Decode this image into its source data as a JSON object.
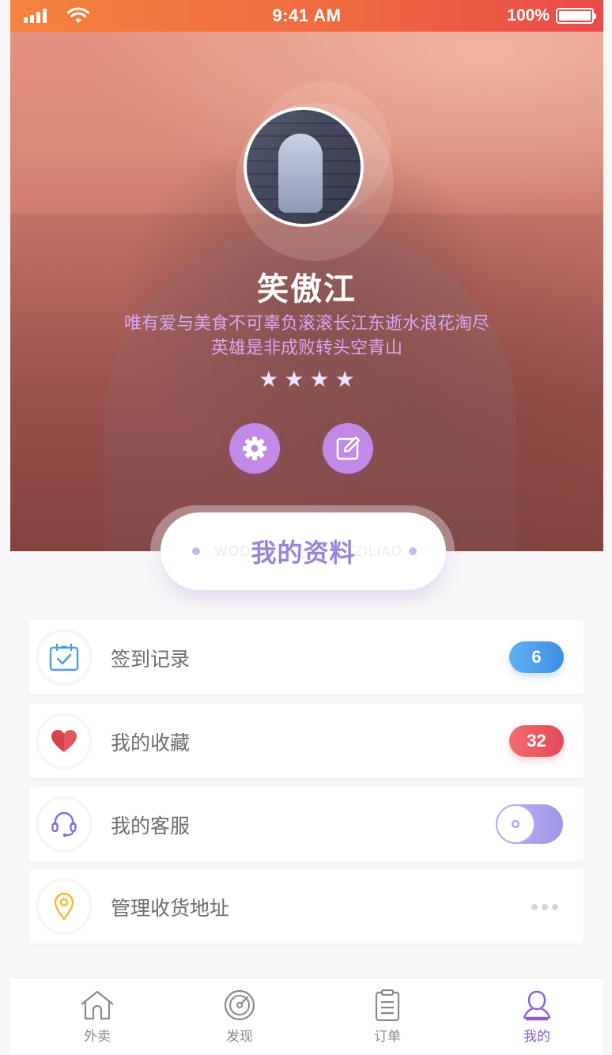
{
  "status_bar": {
    "time": "9:41 AM",
    "battery": "100%"
  },
  "profile": {
    "name": "笑傲江",
    "bio_line1": "唯有爱与美食不可辜负滚滚长江东逝水浪花淘尽",
    "bio_line2": "英雄是非成败转头空青山",
    "star_rating": 4,
    "star_glyph": "★"
  },
  "actions": {
    "settings_icon": "gear-icon",
    "edit_icon": "edit-icon"
  },
  "section": {
    "title": "我的资料",
    "sub_left": "WOD",
    "sub_right": "ZILIAO"
  },
  "menu": [
    {
      "label": "签到记录",
      "icon": "calendar-check-icon",
      "badge": "6",
      "badge_color": "#4b9be8"
    },
    {
      "label": "我的收藏",
      "icon": "heart-icon",
      "badge": "32",
      "badge_color": "#e8535d"
    },
    {
      "label": "我的客服",
      "icon": "headset-icon",
      "toggle_on": true
    },
    {
      "label": "管理收货地址",
      "icon": "location-pin-icon",
      "more": true
    }
  ],
  "tabs": [
    {
      "label": "外卖",
      "icon": "home-icon"
    },
    {
      "label": "发现",
      "icon": "compass-icon"
    },
    {
      "label": "订单",
      "icon": "clipboard-icon"
    },
    {
      "label": "我的",
      "icon": "user-icon",
      "active": true
    }
  ],
  "colors": {
    "accent": "#9b83d8",
    "status_gradient_start": "#f5833e",
    "status_gradient_end": "#ea4a4a"
  }
}
